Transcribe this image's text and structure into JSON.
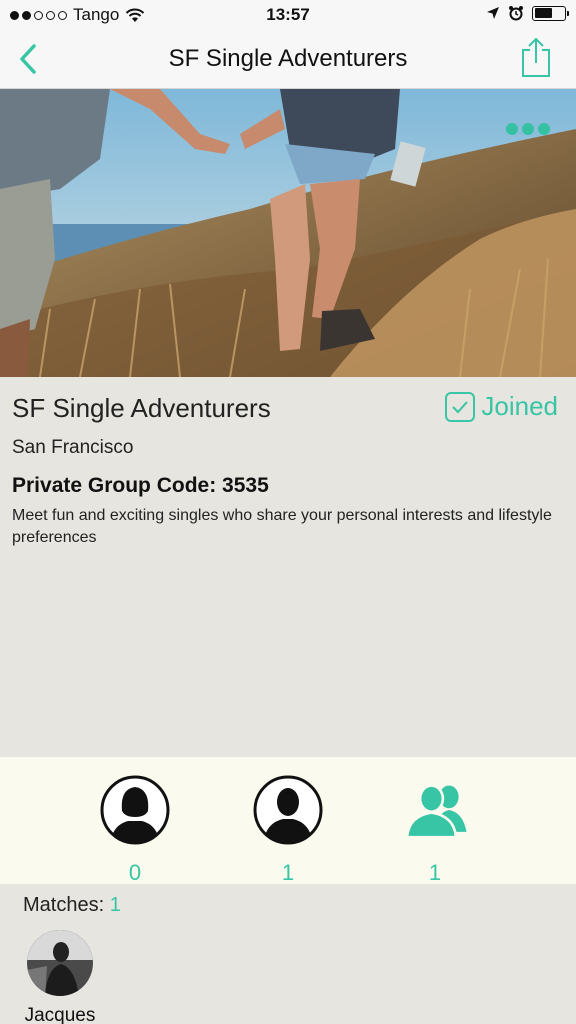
{
  "status_bar": {
    "carrier": "Tango",
    "time": "13:57"
  },
  "nav": {
    "title": "SF Single Adventurers",
    "back_icon": "chevron-left-icon",
    "share_icon": "share-icon"
  },
  "hero": {
    "more_icon": "more-dots-icon"
  },
  "group": {
    "name": "SF Single Adventurers",
    "joined_label": "Joined",
    "city": "San Francisco",
    "code_label": "Private Group Code: 3535",
    "description": "Meet fun and exciting singles who share your personal interests and lifestyle preferences"
  },
  "stats": {
    "female_count": "0",
    "male_count": "1",
    "group_count": "1"
  },
  "matches": {
    "label": "Matches: ",
    "count": "1",
    "items": [
      {
        "name": "Jacques"
      }
    ]
  },
  "colors": {
    "accent": "#37c5a5",
    "background": "#e6e5df",
    "stats_background": "#fbfaee"
  }
}
